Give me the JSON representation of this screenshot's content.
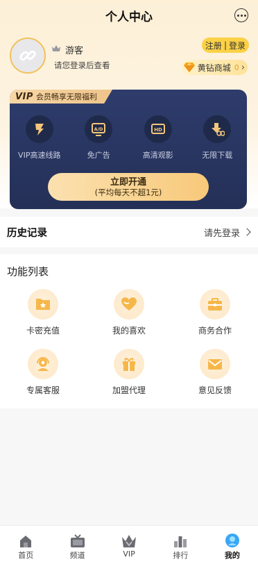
{
  "header": {
    "title": "个人中心"
  },
  "profile": {
    "username": "游客",
    "login_hint": "请您登录后查看",
    "register_label": "注册",
    "divider": "|",
    "login_label": "登录",
    "shop_label": "黄钻商城",
    "shop_count": "0"
  },
  "vip": {
    "logo": "VIP",
    "tag_text": "会员畅享无限福利",
    "features": [
      {
        "label": "VIP高速线路",
        "icon": "fast-line-icon"
      },
      {
        "label": "免广告",
        "icon": "no-ads-icon"
      },
      {
        "label": "高清观影",
        "icon": "hd-icon"
      },
      {
        "label": "无限下载",
        "icon": "download-icon"
      }
    ],
    "open_main": "立即开通",
    "open_sub": "(平均每天不超1元)"
  },
  "history": {
    "title": "历史记录",
    "link": "请先登录"
  },
  "functions": {
    "title": "功能列表",
    "items": [
      {
        "label": "卡密充值",
        "icon": "card-folder-icon"
      },
      {
        "label": "我的喜欢",
        "icon": "heart-icon"
      },
      {
        "label": "商务合作",
        "icon": "briefcase-icon"
      },
      {
        "label": "专属客服",
        "icon": "customer-service-icon"
      },
      {
        "label": "加盟代理",
        "icon": "gift-icon"
      },
      {
        "label": "意见反馈",
        "icon": "envelope-icon"
      }
    ]
  },
  "tabbar": {
    "items": [
      {
        "label": "首页",
        "icon": "home-icon"
      },
      {
        "label": "频道",
        "icon": "tv-icon"
      },
      {
        "label": "VIP",
        "icon": "vip-crown-icon"
      },
      {
        "label": "排行",
        "icon": "ranking-icon"
      },
      {
        "label": "我的",
        "icon": "profile-icon",
        "active": true
      }
    ]
  },
  "colors": {
    "accent": "#fbd146",
    "vip_bg": "#2e3c6d",
    "gold": "#f7c97a",
    "icon_orange": "#f6b74a"
  }
}
